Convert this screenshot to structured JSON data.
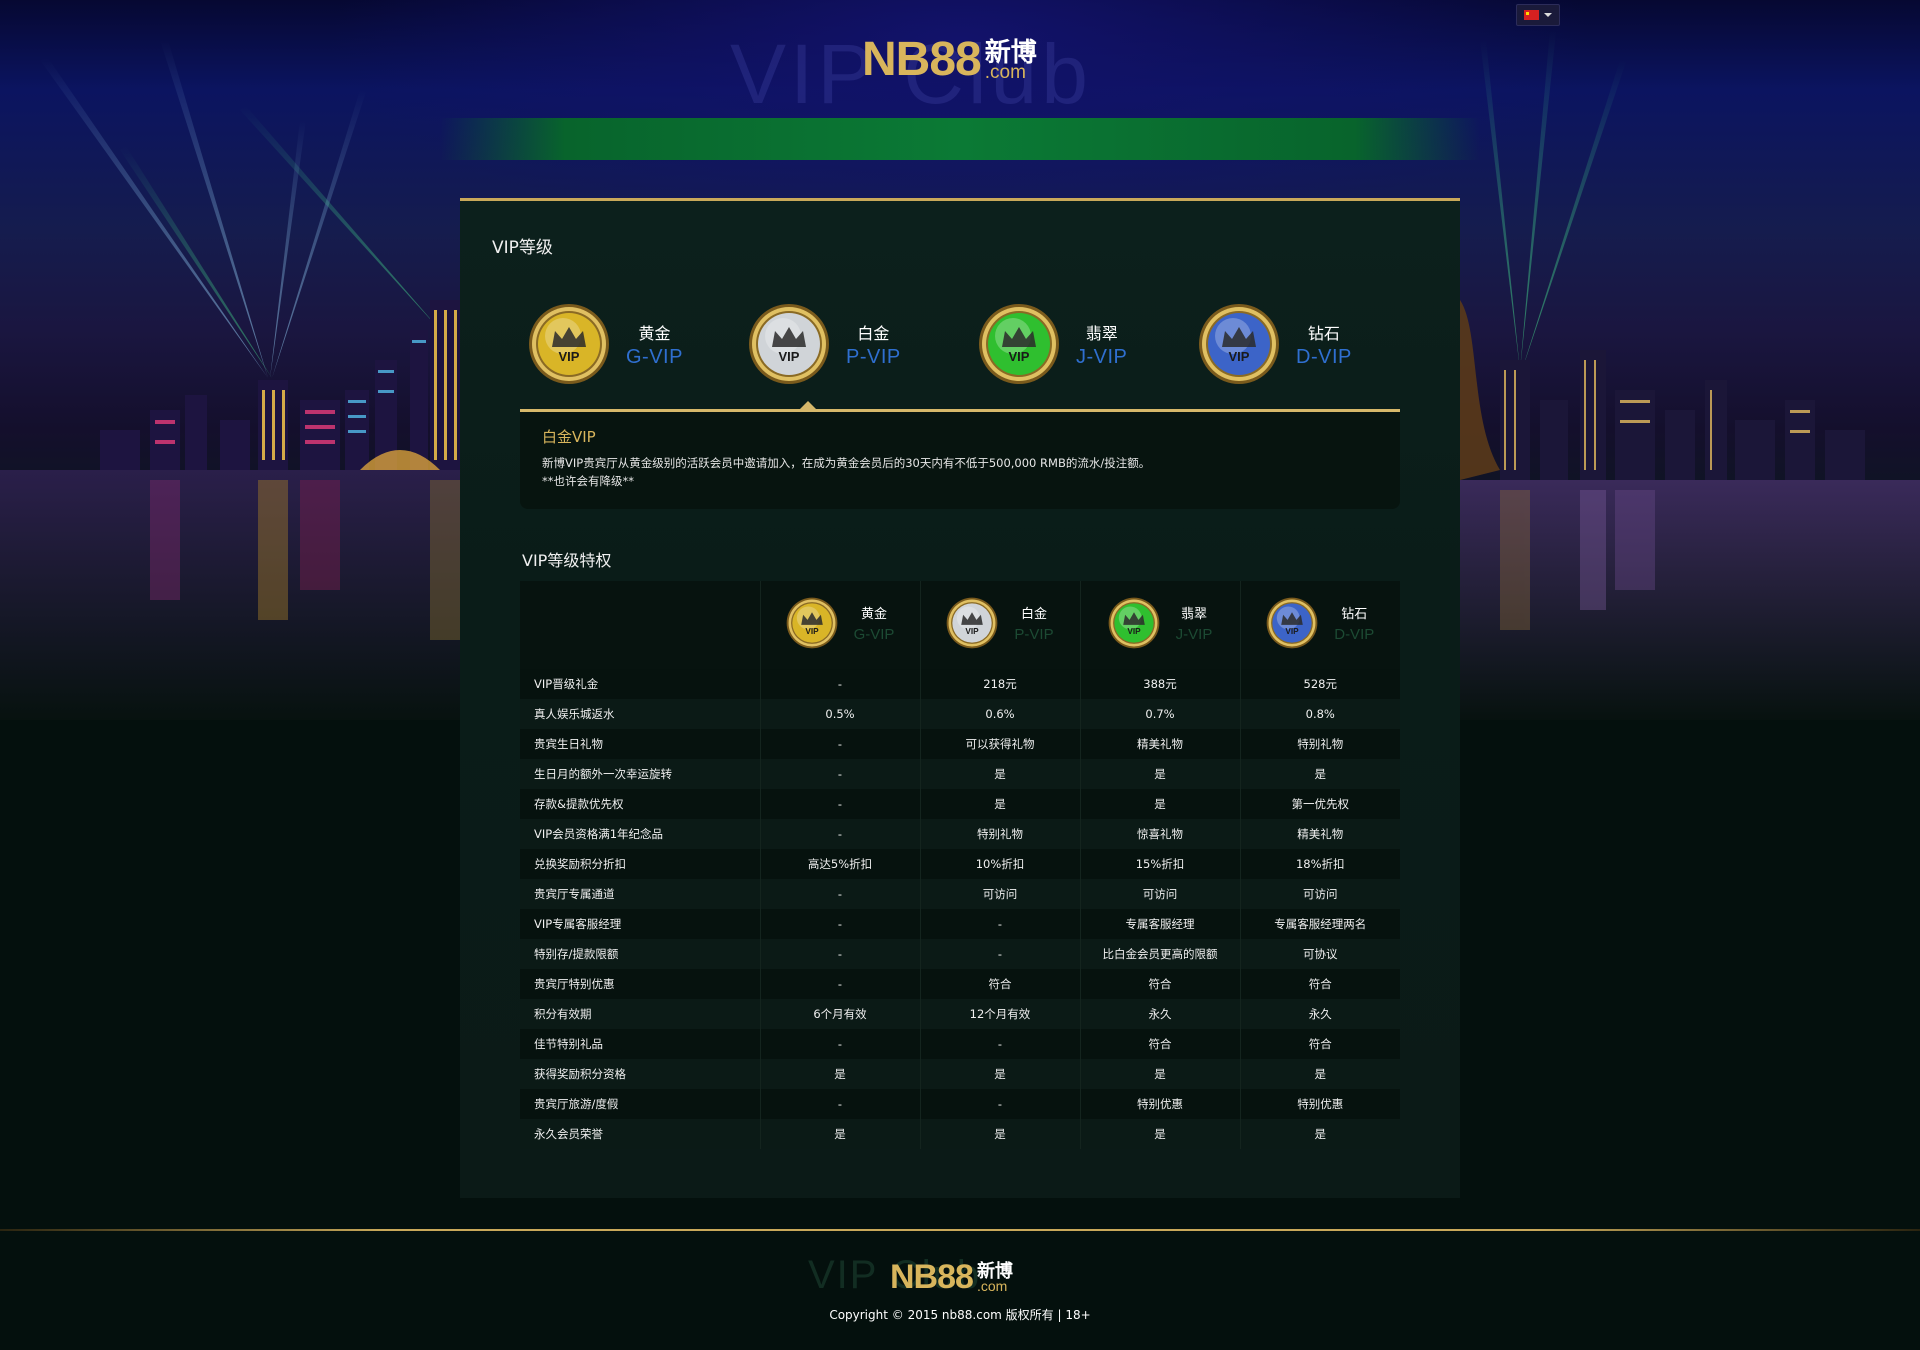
{
  "header": {
    "logo_main": "NB88",
    "logo_cn": "新博",
    "logo_com": ".com",
    "bg_watermark": "VIP Club",
    "language": {
      "icon": "flag-cn-icon",
      "caret_icon": "caret-down-icon"
    }
  },
  "panel": {
    "title": "VIP等级",
    "levels": [
      {
        "cn": "黄金",
        "en": "G-VIP",
        "badge_color": "#d9b527",
        "icon": "gold-vip-badge-icon"
      },
      {
        "cn": "白金",
        "en": "P-VIP",
        "badge_color": "#d0d4d8",
        "icon": "platinum-vip-badge-icon"
      },
      {
        "cn": "翡翠",
        "en": "J-VIP",
        "badge_color": "#2fbf2f",
        "icon": "jade-vip-badge-icon"
      },
      {
        "cn": "钻石",
        "en": "D-VIP",
        "badge_color": "#3c64c8",
        "icon": "diamond-vip-badge-icon"
      }
    ],
    "selected_level": "白金",
    "description": {
      "title": "白金VIP",
      "body_line1": "新博VIP贵宾厅从黄金级别的活跃会员中邀请加入，在成为黄金会员后的30天内有不低于500,000 RMB的流水/投注额。",
      "body_line2": "**也许会有降级**"
    }
  },
  "privileges": {
    "title": "VIP等级特权",
    "rows": [
      {
        "label": "VIP晋级礼金",
        "values": [
          "-",
          "218元",
          "388元",
          "528元"
        ]
      },
      {
        "label": "真人娱乐城返水",
        "values": [
          "0.5%",
          "0.6%",
          "0.7%",
          "0.8%"
        ]
      },
      {
        "label": "贵宾生日礼物",
        "values": [
          "-",
          "可以获得礼物",
          "精美礼物",
          "特别礼物"
        ]
      },
      {
        "label": "生日月的额外一次幸运旋转",
        "values": [
          "-",
          "是",
          "是",
          "是"
        ]
      },
      {
        "label": "存款&提款优先权",
        "values": [
          "-",
          "是",
          "是",
          "第一优先权"
        ]
      },
      {
        "label": "VIP会员资格满1年纪念品",
        "values": [
          "-",
          "特别礼物",
          "惊喜礼物",
          "精美礼物"
        ]
      },
      {
        "label": "兑换奖励积分折扣",
        "values": [
          "高达5%折扣",
          "10%折扣",
          "15%折扣",
          "18%折扣"
        ]
      },
      {
        "label": "贵宾厅专属通道",
        "values": [
          "-",
          "可访问",
          "可访问",
          "可访问"
        ]
      },
      {
        "label": "VIP专属客服经理",
        "values": [
          "-",
          "-",
          "专属客服经理",
          "专属客服经理两名"
        ]
      },
      {
        "label": "特别存/提款限额",
        "values": [
          "-",
          "-",
          "比白金会员更高的限额",
          "可协议"
        ]
      },
      {
        "label": "贵宾厅特别优惠",
        "values": [
          "-",
          "符合",
          "符合",
          "符合"
        ]
      },
      {
        "label": "积分有效期",
        "values": [
          "6个月有效",
          "12个月有效",
          "永久",
          "永久"
        ]
      },
      {
        "label": "佳节特别礼品",
        "values": [
          "-",
          "-",
          "符合",
          "符合"
        ]
      },
      {
        "label": "获得奖励积分资格",
        "values": [
          "是",
          "是",
          "是",
          "是"
        ]
      },
      {
        "label": "贵宾厅旅游/度假",
        "values": [
          "-",
          "-",
          "特别优惠",
          "特别优惠"
        ]
      },
      {
        "label": "永久会员荣誉",
        "values": [
          "是",
          "是",
          "是",
          "是"
        ]
      }
    ]
  },
  "footer": {
    "logo_main": "NB88",
    "logo_cn": "新博",
    "logo_com": ".com",
    "bg_watermark": "VIP Club",
    "copyright": "Copyright © 2015 nb88.com  版权所有 | 18+"
  },
  "colors": {
    "gold_accent": "#c9a95a",
    "level_en_blue": "#2f6fd0",
    "description_title": "#d8b55c",
    "panel_bg": "#0c201c"
  }
}
